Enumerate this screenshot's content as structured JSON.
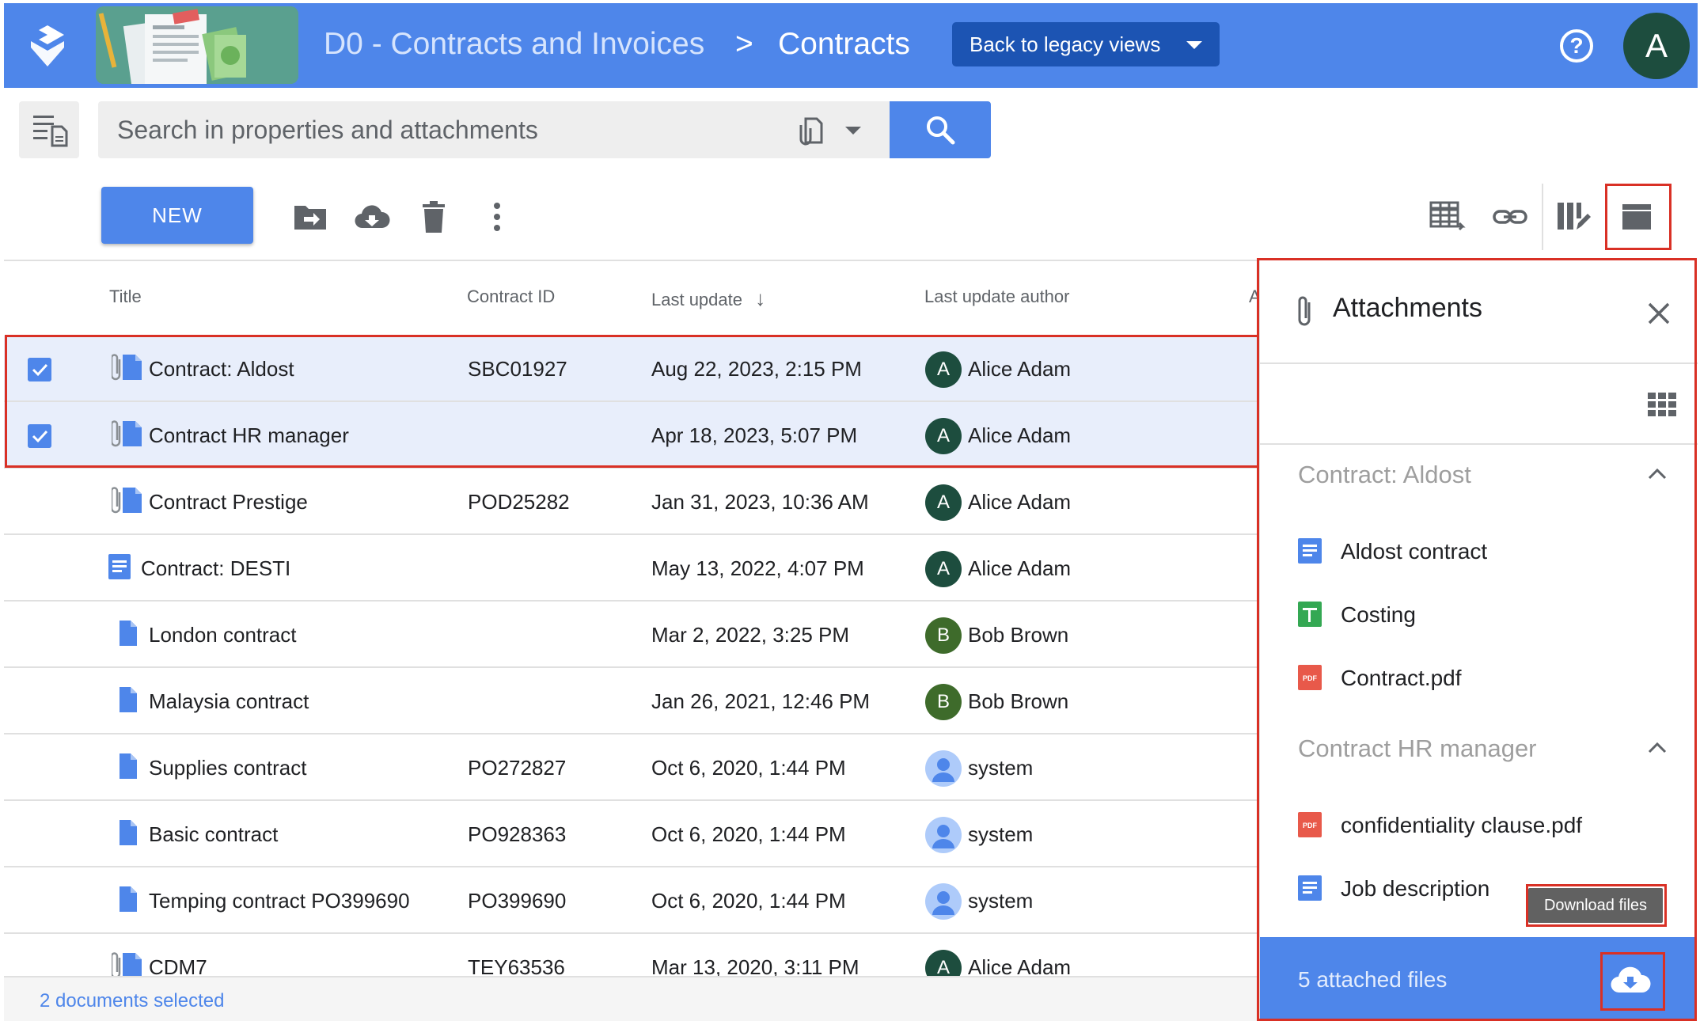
{
  "header": {
    "breadcrumb_root": "D0 - Contracts and Invoices",
    "breadcrumb_sep": ">",
    "breadcrumb_current": "Contracts",
    "legacy_button": "Back to legacy views",
    "help_label": "?",
    "avatar_letter": "A"
  },
  "search": {
    "placeholder": "Search in properties and attachments"
  },
  "toolbar": {
    "new_label": "NEW"
  },
  "table": {
    "columns": {
      "title": "Title",
      "contract_id": "Contract ID",
      "last_update": "Last update",
      "sort_indicator": "↓",
      "author": "Last update author",
      "extra": "A"
    },
    "rows": [
      {
        "title": "Contract: Aldost",
        "id": "SBC01927",
        "date": "Aug 22, 2023, 2:15 PM",
        "author": "Alice Adam",
        "initial": "A",
        "avatar_color": "#1d4d3e",
        "icon": "attached-file-icon",
        "selected": true
      },
      {
        "title": "Contract HR manager",
        "id": "",
        "date": "Apr 18, 2023, 5:07 PM",
        "author": "Alice Adam",
        "initial": "A",
        "avatar_color": "#1d4d3e",
        "icon": "attached-file-icon",
        "selected": true
      },
      {
        "title": "Contract Prestige",
        "id": "POD25282",
        "date": "Jan 31, 2023, 10:36 AM",
        "author": "Alice Adam",
        "initial": "A",
        "avatar_color": "#1d4d3e",
        "icon": "attached-file-icon",
        "selected": false
      },
      {
        "title": "Contract: DESTI",
        "id": "",
        "date": "May 13, 2022, 4:07 PM",
        "author": "Alice Adam",
        "initial": "A",
        "avatar_color": "#1d4d3e",
        "icon": "google-doc-icon",
        "selected": false
      },
      {
        "title": "London contract",
        "id": "",
        "date": "Mar 2, 2022, 3:25 PM",
        "author": "Bob Brown",
        "initial": "B",
        "avatar_color": "#3e6b2b",
        "icon": "file-icon",
        "selected": false
      },
      {
        "title": "Malaysia contract",
        "id": "",
        "date": "Jan 26, 2021, 12:46 PM",
        "author": "Bob Brown",
        "initial": "B",
        "avatar_color": "#3e6b2b",
        "icon": "file-icon",
        "selected": false
      },
      {
        "title": "Supplies contract",
        "id": "PO272827",
        "date": "Oct 6, 2020, 1:44 PM",
        "author": "system",
        "initial": "",
        "avatar_color": "#aecbfa",
        "icon": "file-icon",
        "selected": false
      },
      {
        "title": "Basic contract",
        "id": "PO928363",
        "date": "Oct 6, 2020, 1:44 PM",
        "author": "system",
        "initial": "",
        "avatar_color": "#aecbfa",
        "icon": "file-icon",
        "selected": false
      },
      {
        "title": "Temping contract PO399690",
        "id": "PO399690",
        "date": "Oct 6, 2020, 1:44 PM",
        "author": "system",
        "initial": "",
        "avatar_color": "#aecbfa",
        "icon": "file-icon",
        "selected": false
      },
      {
        "title": "CDM7",
        "id": "TEY63536",
        "date": "Mar 13, 2020, 3:11 PM",
        "author": "Alice Adam",
        "initial": "A",
        "avatar_color": "#1d4d3e",
        "icon": "attached-file-icon",
        "selected": false
      }
    ]
  },
  "status": {
    "selection_text": "2 documents selected"
  },
  "attachments": {
    "title": "Attachments",
    "groups": [
      {
        "name": "Contract: Aldost",
        "files": [
          {
            "label": "Aldost contract",
            "icon": "google-doc-icon"
          },
          {
            "label": "Costing",
            "icon": "google-sheet-icon"
          },
          {
            "label": "Contract.pdf",
            "icon": "pdf-icon"
          }
        ]
      },
      {
        "name": "Contract HR manager",
        "files": [
          {
            "label": "confidentiality clause.pdf",
            "icon": "pdf-icon"
          },
          {
            "label": "Job description",
            "icon": "google-doc-icon"
          }
        ]
      }
    ],
    "tooltip": "Download files",
    "footer_text": "5 attached files"
  },
  "colors": {
    "accent": "#4e86ea",
    "highlight": "#d93025",
    "selected_row": "#e8eefb"
  }
}
